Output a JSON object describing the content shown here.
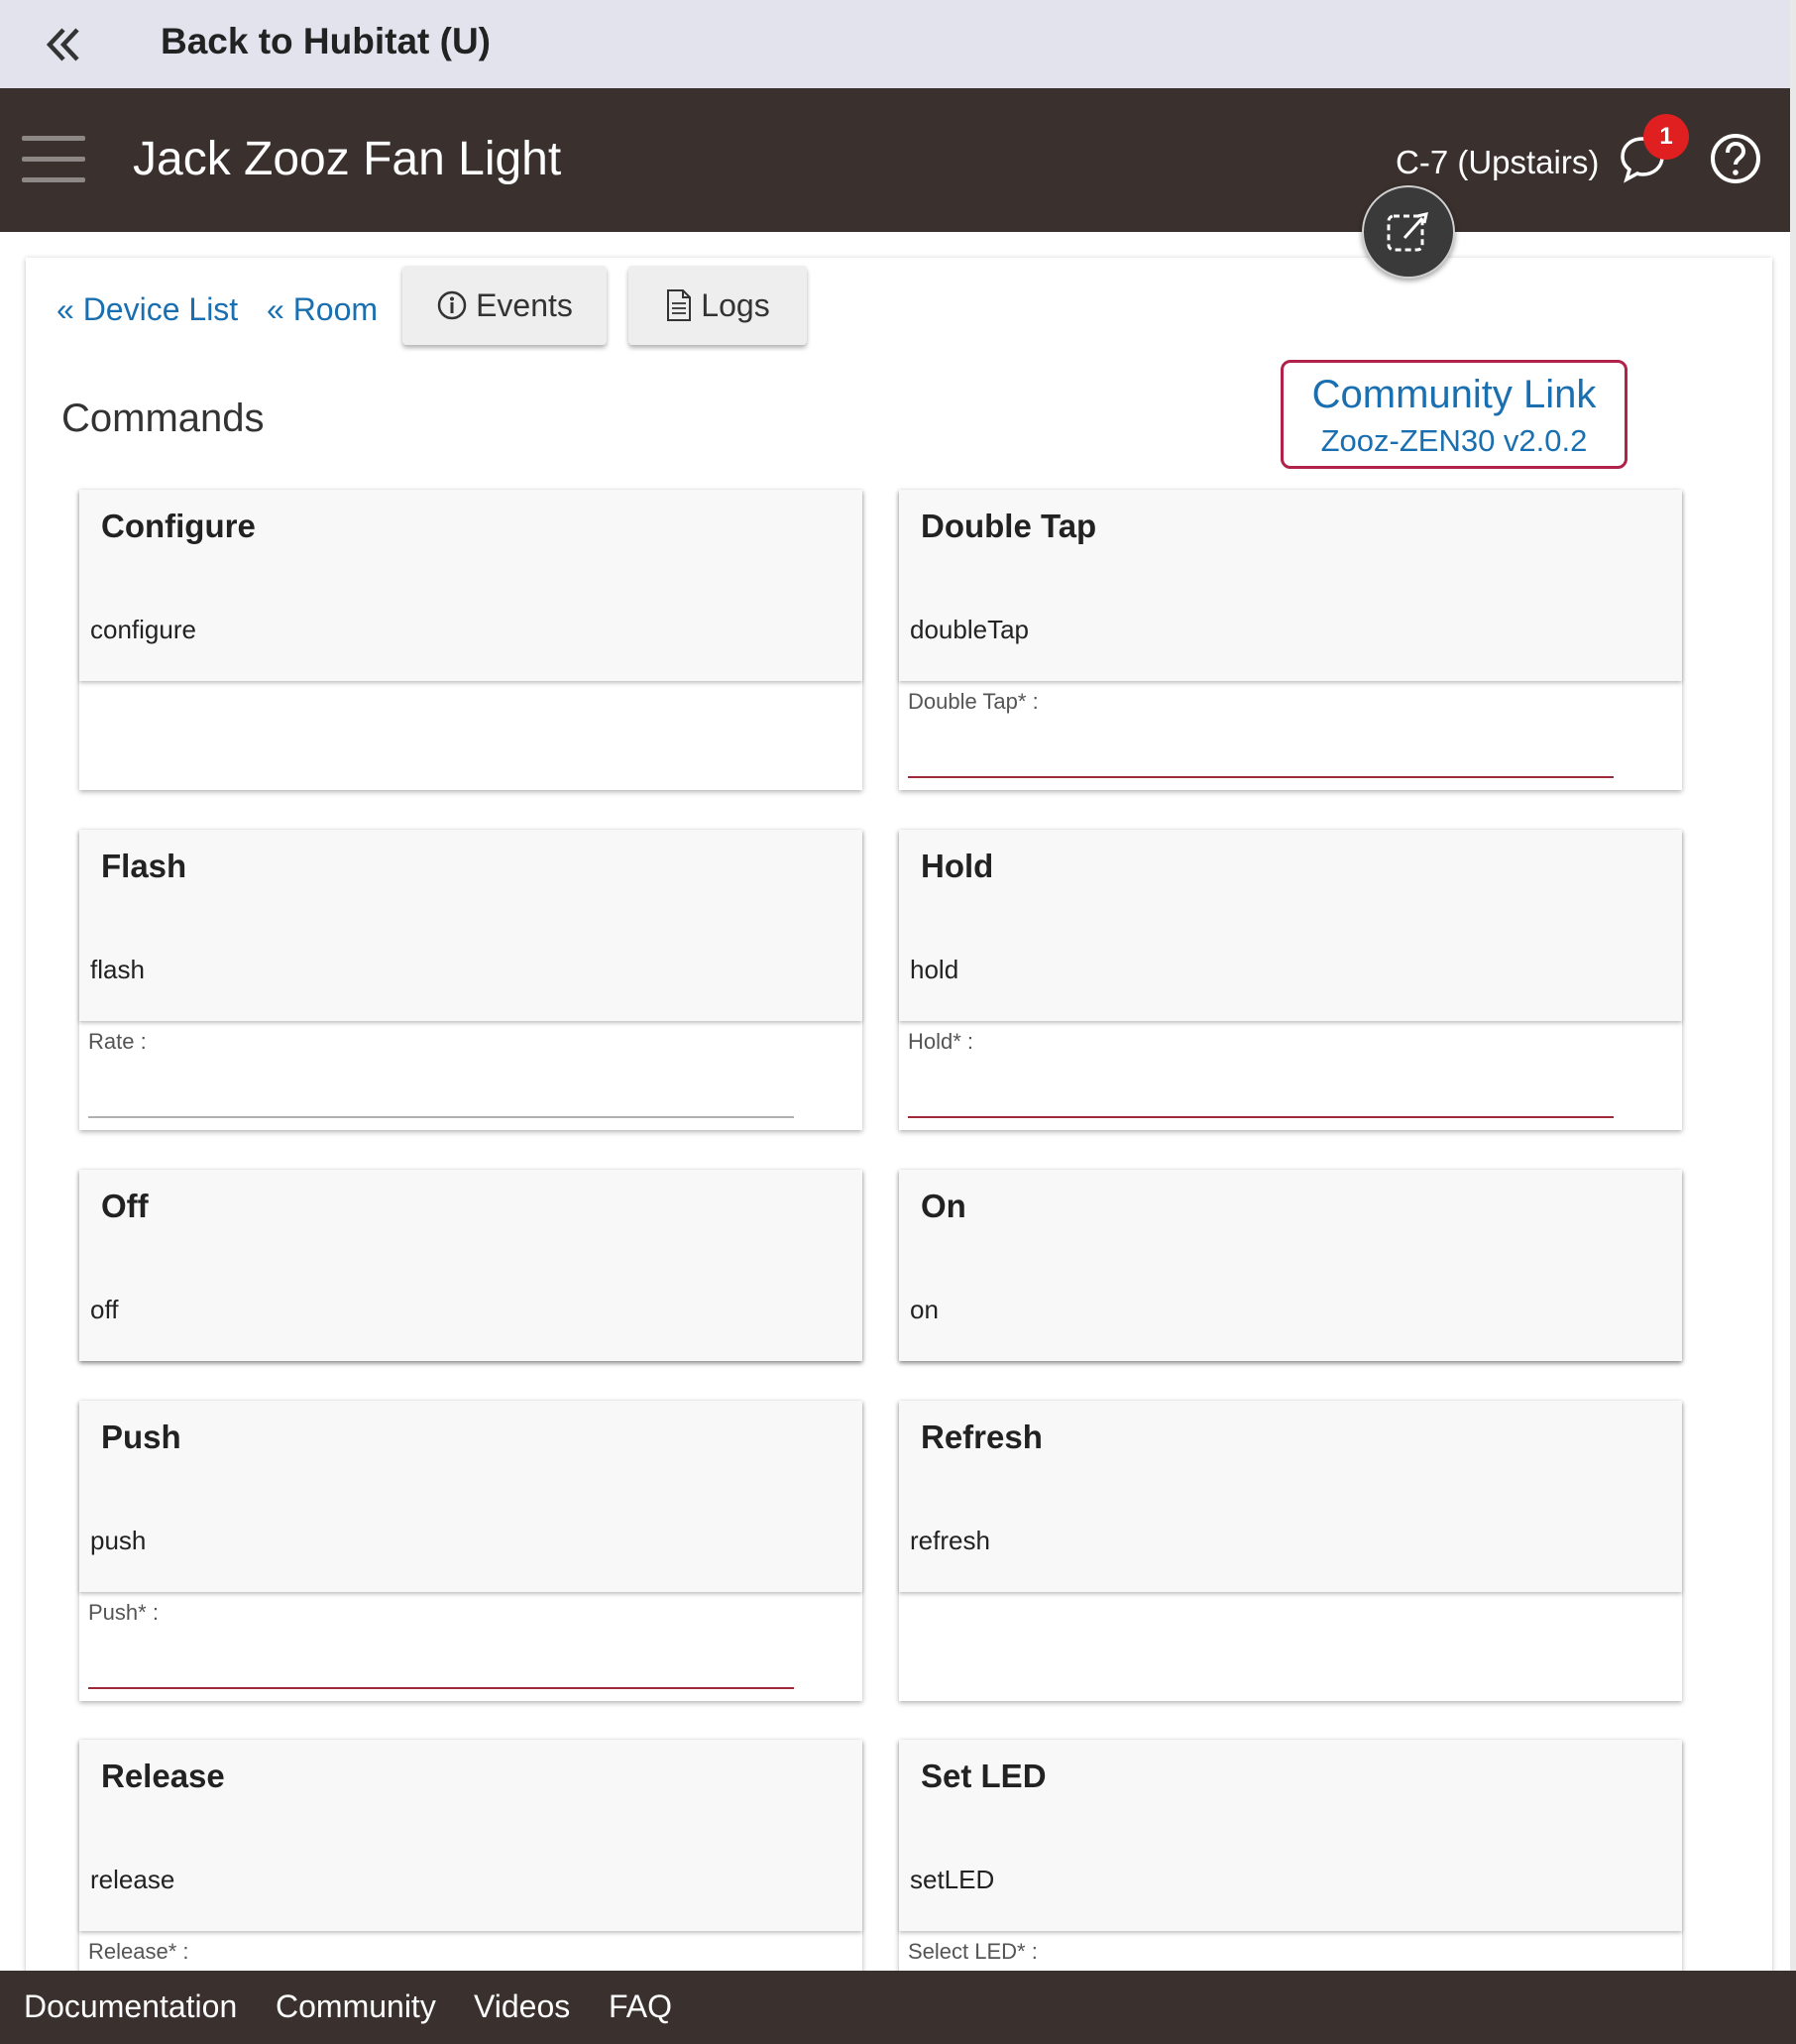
{
  "back_bar": {
    "label": "Back to Hubitat (U)"
  },
  "header": {
    "title": "Jack Zooz Fan Light",
    "hub_name": "C-7 (Upstairs)",
    "notification_count": "1"
  },
  "nav": {
    "device_list": "« Device List",
    "room": "« Room",
    "events": "Events",
    "logs": "Logs"
  },
  "commands_title": "Commands",
  "community_link": {
    "title": "Community Link",
    "subtitle": "Zooz-ZEN30 v2.0.2"
  },
  "commands": [
    {
      "title": "Configure",
      "name": "configure",
      "field": ""
    },
    {
      "title": "Double Tap",
      "name": "doubleTap",
      "field": "Double Tap* :"
    },
    {
      "title": "Flash",
      "name": "flash",
      "field": "Rate :"
    },
    {
      "title": "Hold",
      "name": "hold",
      "field": "Hold* :"
    },
    {
      "title": "Off",
      "name": "off",
      "field": ""
    },
    {
      "title": "On",
      "name": "on",
      "field": ""
    },
    {
      "title": "Push",
      "name": "push",
      "field": "Push* :"
    },
    {
      "title": "Refresh",
      "name": "refresh",
      "field": ""
    },
    {
      "title": "Release",
      "name": "release",
      "field": "Release* :"
    },
    {
      "title": "Set LED",
      "name": "setLED",
      "field": "Select LED* :"
    }
  ],
  "footer": {
    "documentation": "Documentation",
    "community": "Community",
    "videos": "Videos",
    "faq": "FAQ"
  },
  "colors": {
    "header_bg": "#3a302d",
    "link": "#1a6fb0",
    "accent_border": "#b0224a",
    "badge": "#e02020"
  }
}
